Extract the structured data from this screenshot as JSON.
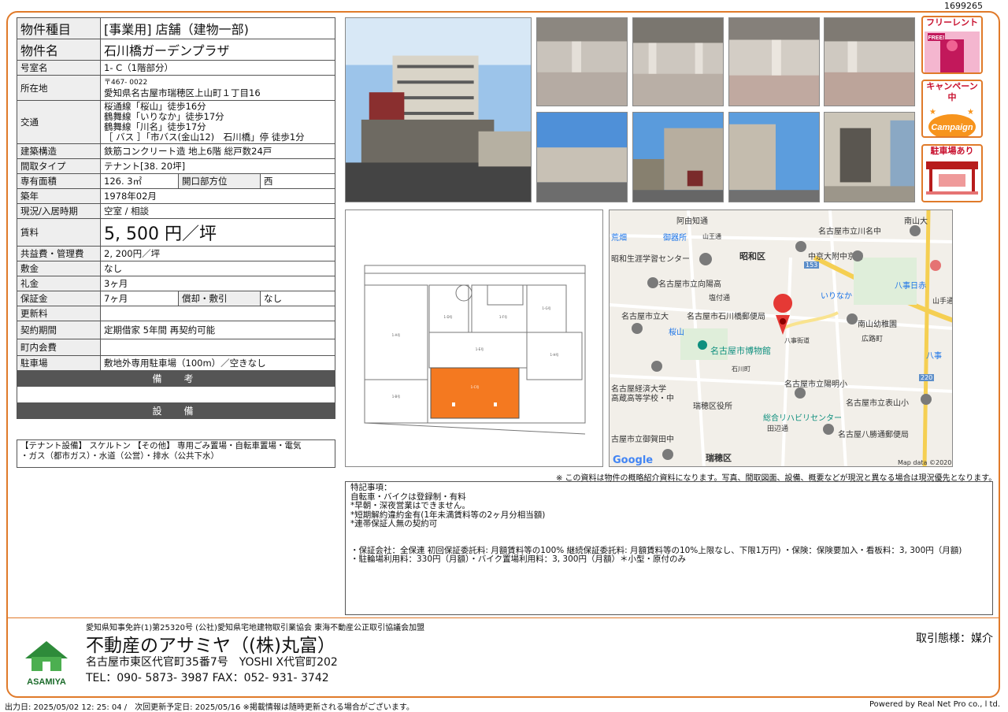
{
  "doc_number": "1699265",
  "spec": {
    "rows": [
      {
        "k": "物件種目",
        "v": "[事業用] 店舗（建物一部)"
      },
      {
        "k": "物件名",
        "v": "石川橋ガーデンプラザ"
      },
      {
        "k": "号室名",
        "v": "1- C（1階部分）"
      },
      {
        "k": "所在地",
        "v1": "〒467- 0022",
        "v2": "愛知県名古屋市瑞穂区上山町１丁目16"
      },
      {
        "k": "交通",
        "lines": [
          "桜通線「桜山」徒歩16分",
          "鶴舞線「いりなか」徒歩17分",
          "鶴舞線「川名」徒歩17分",
          "［ バス ］「市バス(金山12)　石川橋」停 徒歩1分"
        ]
      },
      {
        "k": "建築構造",
        "v": "鉄筋コンクリート造 地上6階 総戸数24戸"
      },
      {
        "k": "間取タイプ",
        "v": "テナント[38. 20坪]"
      }
    ],
    "area_k": "専有面積",
    "area_v": "126. 3㎡",
    "dir_k": "開口部方位",
    "dir_v": "西",
    "built_k": "築年",
    "built_v": "1978年02月",
    "status_k": "現況/入居時期",
    "status_v": "空室 / 相談",
    "rent_k": "賃料",
    "rent_v": "5, 500 円／坪",
    "fee_k": "共益費・管理費",
    "fee_v": "2, 200円／坪",
    "deposit_k": "敷金",
    "deposit_v": "なし",
    "key_k": "礼金",
    "key_v": "3ヶ月",
    "guar_k": "保証金",
    "guar_v": "7ヶ月",
    "amort_k": "償却・敷引",
    "amort_v": "なし",
    "renew_k": "更新料",
    "renew_v": "",
    "contract_k": "契約期間",
    "contract_v": "定期借家 5年間 再契約可能",
    "assoc_k": "町内会費",
    "assoc_v": "",
    "parking_k": "駐車場",
    "parking_v": "敷地外専用駐車場（100m）／空きなし",
    "bikou": "備　考",
    "setsubi": "設　備"
  },
  "equipment": [
    "【テナント設備】 スケルトン 【その他】 専用ごみ置場・自転車置場・電気",
    "・ガス（都市ガス）・水道（公営）・排水（公共下水）"
  ],
  "badges": {
    "free_rent": "フリーレント",
    "free": "FREE!",
    "campaign": "キャンペーン中",
    "campaign_sub": "Campaign",
    "parking": "駐車場あり"
  },
  "plan_rooms": [
    "1-A号",
    "1-B号",
    "1-C号",
    "1-D号",
    "1-E号",
    "1-F号",
    "1-G号",
    "1-H号"
  ],
  "map": {
    "labels": [
      "阿由知通",
      "荒畑",
      "御器所",
      "山王通",
      "名古屋市立川名中",
      "南山大",
      "昭和生涯学習センター",
      "昭和区",
      "中京大附中京高",
      "名古屋市立向陽高",
      "塩付通",
      "いりなか",
      "八事日赤",
      "名古屋市立大",
      "名古屋市石川橋郵便局",
      "南山幼稚園",
      "山手通",
      "桜山",
      "名古屋市博物館",
      "八事街道",
      "広路町",
      "石川町",
      "八事",
      "名古屋経済大学",
      "高蔵高等学校・中",
      "瑞穂区役所",
      "名古屋市立陽明小",
      "名古屋市立表山小",
      "総合リハビリセンター",
      "田辺通",
      "古屋市立御賀田中",
      "名古屋八勝通郵便局",
      "瑞穂区",
      "Google",
      "Map data ©2020",
      "153",
      "220"
    ]
  },
  "note": "※ この資料は物件の概略紹介資料になります。写真、間取図面、設備、概要などが現況と異なる場合は現況優先となります。",
  "remarks": [
    "特記事項：",
    "自転車・バイクは登録制・有料",
    "*早朝・深夜営業はできません。",
    "*短期解約違約金有(1年未満賃料等の2ヶ月分相当額)",
    "*連帯保証人無の契約可",
    "",
    "",
    "・保証会社：全保連 初回保証委託料: 月額賃料等の100% 継続保証委託料: 月額賃料等の10%上限なし、下限1万円) ・保険：保険要加入・看板料：3, 300円（月額)",
    "・駐輪場利用料：330円（月額）・バイク置場利用料：3, 300円（月額）＊小型・原付のみ"
  ],
  "footer": {
    "license": "愛知県知事免許(1)第25320号 (公社)愛知県宅地建物取引業協会 東海不動産公正取引協議会加盟",
    "company": "不動産のアサミヤ（(株)丸富）",
    "address": "名古屋市東区代官町35番7号　YOSHI X代官町202",
    "tel": "TEL：090- 5873- 3987 FAX：052- 931- 3742",
    "deal": "取引態様：媒介",
    "logo": "ASAMIYA",
    "output": "出力日: 2025/05/02 12: 25: 04 /　次回更新予定日: 2025/05/16 ※掲載情報は随時更新される場合がございます。",
    "powered": "Powered by Real Net Pro co., l td."
  }
}
